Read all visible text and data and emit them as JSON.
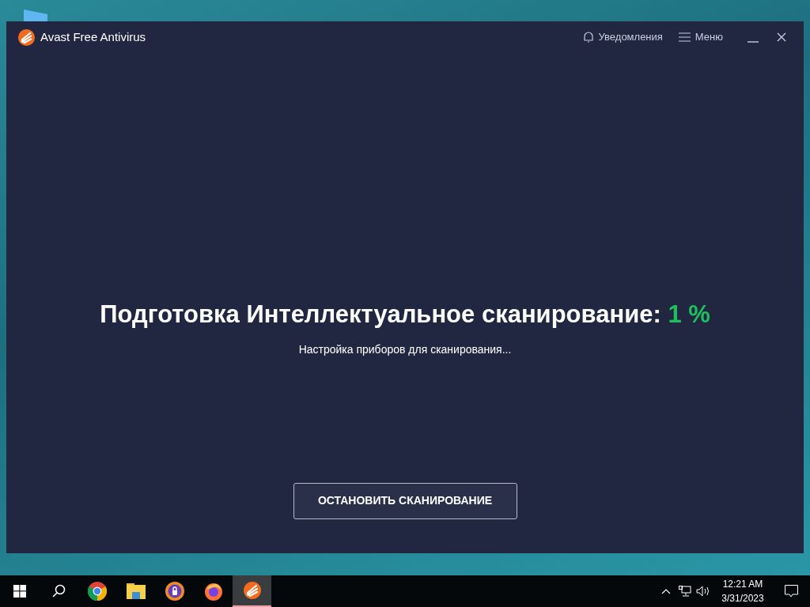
{
  "window": {
    "title": "Avast Free Antivirus",
    "header_actions": [
      {
        "kind": "notifications",
        "label": "Уведомления"
      },
      {
        "kind": "menu",
        "label": "Меню"
      }
    ],
    "controls": [
      {
        "kind": "minimize"
      },
      {
        "kind": "close"
      }
    ]
  },
  "scan": {
    "title": "Подготовка Интеллектуальное сканирование:",
    "percent": "1 %",
    "status": "Настройка приборов для сканирования...",
    "button": "ОСТАНОВИТЬ СКАНИРОВАНИЕ"
  },
  "taskbar": {
    "apps": [
      {
        "kind": "start",
        "selected": false
      },
      {
        "kind": "search",
        "selected": false
      },
      {
        "kind": "chrome",
        "selected": false
      },
      {
        "kind": "explorer",
        "selected": false
      },
      {
        "kind": "secure-browser",
        "selected": false
      },
      {
        "kind": "firefox",
        "selected": false
      },
      {
        "kind": "avast",
        "selected": true
      }
    ],
    "time": "12:21 AM",
    "date": "3/31/2023"
  }
}
